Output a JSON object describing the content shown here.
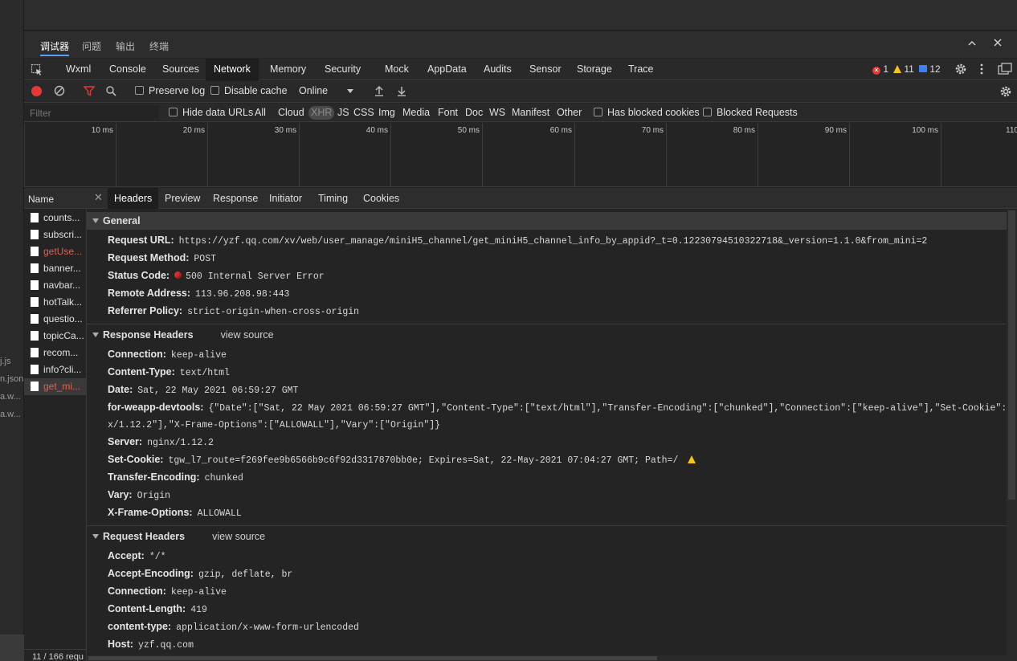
{
  "side_files": [
    "j.js",
    "n.json",
    "a.w...",
    "a.w..."
  ],
  "panel_tabs": [
    "调试器",
    "问题",
    "输出",
    "终端"
  ],
  "tool_tabs": [
    "Wxml",
    "Console",
    "Sources",
    "Network",
    "Memory",
    "Security",
    "Mock",
    "AppData",
    "Audits",
    "Sensor",
    "Storage",
    "Trace"
  ],
  "active_tool_tab": "Network",
  "badges": {
    "errors": "1",
    "warnings": "11",
    "info": "12"
  },
  "netbar": {
    "preserve_log": "Preserve log",
    "disable_cache": "Disable cache",
    "throttle": "Online"
  },
  "filter": {
    "placeholder": "Filter",
    "hide_data_urls": "Hide data URLs",
    "types": [
      "All",
      "Cloud",
      "XHR",
      "JS",
      "CSS",
      "Img",
      "Media",
      "Font",
      "Doc",
      "WS",
      "Manifest",
      "Other"
    ],
    "selected_type": "XHR",
    "has_blocked_cookies": "Has blocked cookies",
    "blocked_requests": "Blocked Requests"
  },
  "timeline_ticks": [
    "10 ms",
    "20 ms",
    "30 ms",
    "40 ms",
    "50 ms",
    "60 ms",
    "70 ms",
    "80 ms",
    "90 ms",
    "100 ms",
    "110"
  ],
  "requests": {
    "header": "Name",
    "items": [
      {
        "name": "counts...",
        "error": false
      },
      {
        "name": "subscri...",
        "error": false
      },
      {
        "name": "getUse...",
        "error": true
      },
      {
        "name": "banner...",
        "error": false
      },
      {
        "name": "navbar...",
        "error": false
      },
      {
        "name": "hotTalk...",
        "error": false
      },
      {
        "name": "questio...",
        "error": false
      },
      {
        "name": "topicCa...",
        "error": false
      },
      {
        "name": "recom...",
        "error": false
      },
      {
        "name": "info?cli...",
        "error": false
      },
      {
        "name": "get_mi...",
        "error": true
      }
    ],
    "footer": "11 / 166 requ"
  },
  "detail_tabs": [
    "Headers",
    "Preview",
    "Response",
    "Initiator",
    "Timing",
    "Cookies"
  ],
  "active_detail_tab": "Headers",
  "general": {
    "title": "General",
    "rows": [
      {
        "k": "Request URL:",
        "v": "https://yzf.qq.com/xv/web/user_manage/miniH5_channel/get_miniH5_channel_info_by_appid?_t=0.12230794510322718&_version=1.1.0&from_mini=2"
      },
      {
        "k": "Request Method:",
        "v": "POST"
      },
      {
        "k": "Status Code:",
        "v": "500 Internal Server Error"
      },
      {
        "k": "Remote Address:",
        "v": "113.96.208.98:443"
      },
      {
        "k": "Referrer Policy:",
        "v": "strict-origin-when-cross-origin"
      }
    ]
  },
  "response_headers": {
    "title": "Response Headers",
    "view_source": "view source",
    "rows": [
      {
        "k": "Connection:",
        "v": "keep-alive"
      },
      {
        "k": "Content-Type:",
        "v": "text/html"
      },
      {
        "k": "Date:",
        "v": "Sat, 22 May 2021 06:59:27 GMT"
      },
      {
        "k": "for-weapp-devtools:",
        "v": "{\"Date\":[\"Sat, 22 May 2021 06:59:27 GMT\"],\"Content-Type\":[\"text/html\"],\"Transfer-Encoding\":[\"chunked\"],\"Connection\":[\"keep-alive\"],\"Set-Cookie\":[\"tgw_l7"
      },
      {
        "k": "",
        "v": "x/1.12.2\"],\"X-Frame-Options\":[\"ALLOWALL\"],\"Vary\":[\"Origin\"]}"
      },
      {
        "k": "Server:",
        "v": "nginx/1.12.2"
      },
      {
        "k": "Set-Cookie:",
        "v": "tgw_l7_route=f269fee9b6566b9c6f92d3317870bb0e; Expires=Sat, 22-May-2021 07:04:27 GMT; Path=/"
      },
      {
        "k": "Transfer-Encoding:",
        "v": "chunked"
      },
      {
        "k": "Vary:",
        "v": "Origin"
      },
      {
        "k": "X-Frame-Options:",
        "v": "ALLOWALL"
      }
    ]
  },
  "request_headers": {
    "title": "Request Headers",
    "view_source": "view source",
    "rows": [
      {
        "k": "Accept:",
        "v": "*/*"
      },
      {
        "k": "Accept-Encoding:",
        "v": "gzip, deflate, br"
      },
      {
        "k": "Connection:",
        "v": "keep-alive"
      },
      {
        "k": "Content-Length:",
        "v": "419"
      },
      {
        "k": "content-type:",
        "v": "application/x-www-form-urlencoded"
      },
      {
        "k": "Host:",
        "v": "yzf.qq.com"
      }
    ]
  },
  "colors": {
    "accent": "#5a9cf8",
    "error_text": "#e0604f",
    "record_red": "#e53935",
    "warning": "#f5c518"
  }
}
